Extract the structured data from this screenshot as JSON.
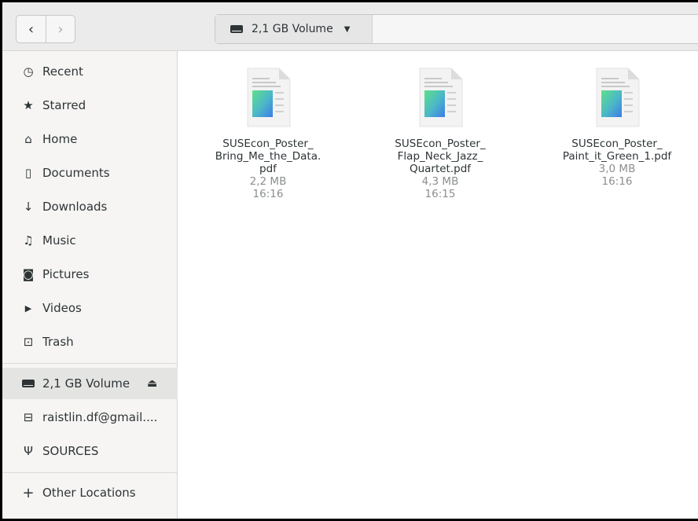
{
  "header": {
    "back_glyph": "‹",
    "forward_glyph": "›",
    "path_label": "2,1 GB Volume",
    "caret_glyph": "▼"
  },
  "sidebar": {
    "items": [
      {
        "label": "Recent",
        "icon": "clock-icon",
        "glyph": "◷"
      },
      {
        "label": "Starred",
        "icon": "star-icon",
        "glyph": "★"
      },
      {
        "label": "Home",
        "icon": "home-icon",
        "glyph": "⌂"
      },
      {
        "label": "Documents",
        "icon": "document-icon",
        "glyph": "▯"
      },
      {
        "label": "Downloads",
        "icon": "download-icon",
        "glyph": "↓"
      },
      {
        "label": "Music",
        "icon": "music-icon",
        "glyph": "♫"
      },
      {
        "label": "Pictures",
        "icon": "camera-icon",
        "glyph": "◙"
      },
      {
        "label": "Videos",
        "icon": "video-icon",
        "glyph": "▶"
      },
      {
        "label": "Trash",
        "icon": "trash-icon",
        "glyph": "⊡"
      }
    ],
    "devices": [
      {
        "label": "2,1 GB Volume",
        "icon": "drive-icon",
        "glyph": "▬",
        "eject": "⏏"
      },
      {
        "label": "raistlin.df@gmail....",
        "icon": "network-drive-icon",
        "glyph": "⊟"
      },
      {
        "label": "SOURCES",
        "icon": "usb-icon",
        "glyph": "Ψ"
      }
    ],
    "other": {
      "label": "Other Locations",
      "icon": "plus-icon",
      "glyph": "+"
    }
  },
  "files": [
    {
      "name_lines": [
        "SUSEcon_Poster_",
        "Bring_Me_the_Data.",
        "pdf"
      ],
      "size": "2,2 MB",
      "time": "16:16"
    },
    {
      "name_lines": [
        "SUSEcon_Poster_",
        "Flap_Neck_Jazz_",
        "Quartet.pdf"
      ],
      "size": "4,3 MB",
      "time": "16:15"
    },
    {
      "name_lines": [
        "SUSEcon_Poster_",
        "Paint_it_Green_1.pdf"
      ],
      "size": "3,0 MB",
      "time": "16:16"
    }
  ]
}
